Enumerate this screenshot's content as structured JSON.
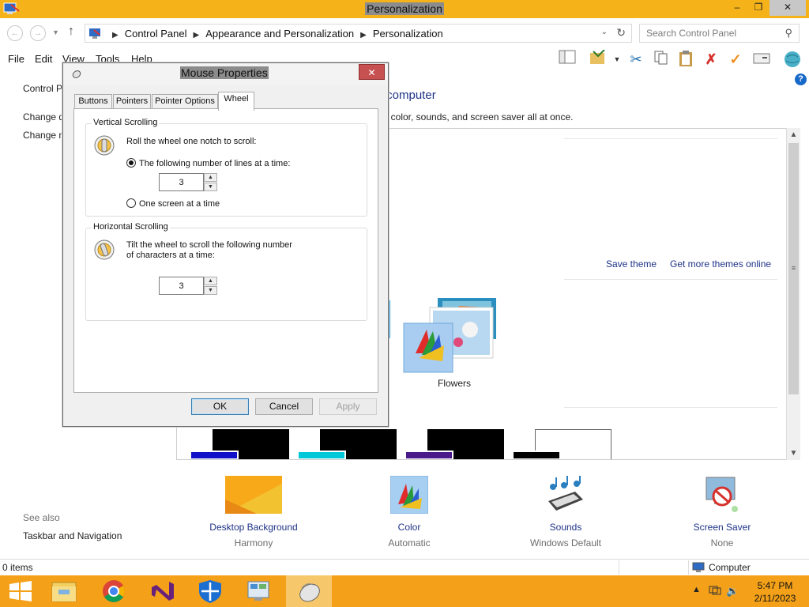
{
  "window": {
    "title": "Personalization",
    "min_label": "‒",
    "max_label": "❐",
    "close_label": "✕"
  },
  "address": {
    "crumbs": [
      "Control Panel",
      "Appearance and Personalization",
      "Personalization"
    ],
    "search_placeholder": "Search Control Panel"
  },
  "menu": [
    "File",
    "Edit",
    "View",
    "Tools",
    "Help"
  ],
  "left_pane": {
    "links": [
      "Control Pa",
      "Change de",
      "Change m"
    ],
    "see_also": "See also",
    "taskbar_link": "Taskbar and Navigation"
  },
  "main": {
    "heading": "r computer",
    "subheading": ", color, sounds, and screen saver all at once.",
    "save_theme": "Save theme",
    "get_more": "Get more themes online",
    "theme_name": "Flowers"
  },
  "bottom_items": [
    {
      "label": "Desktop Background",
      "sub": "Harmony"
    },
    {
      "label": "Color",
      "sub": "Automatic"
    },
    {
      "label": "Sounds",
      "sub": "Windows Default"
    },
    {
      "label": "Screen Saver",
      "sub": "None"
    }
  ],
  "status": {
    "items": "0 items",
    "location": "Computer"
  },
  "clock": {
    "time": "5:47 PM",
    "date": "2/11/2023"
  },
  "dialog": {
    "title": "Mouse Properties",
    "close_label": "✕",
    "tabs": [
      "Buttons",
      "Pointers",
      "Pointer Options",
      "Wheel"
    ],
    "active_tab": "Wheel",
    "vertical": {
      "group_label": "Vertical Scrolling",
      "instruction": "Roll the wheel one notch to scroll:",
      "option_lines": "The following number of lines at a time:",
      "lines_value": "3",
      "option_screen": "One screen at a time",
      "selected": "lines"
    },
    "horizontal": {
      "group_label": "Horizontal Scrolling",
      "instruction_line1": "Tilt the wheel to scroll the following number",
      "instruction_line2": "of characters at a time:",
      "chars_value": "3"
    },
    "buttons": {
      "ok": "OK",
      "cancel": "Cancel",
      "apply": "Apply"
    }
  },
  "colors": {
    "title_bar": "#f5b319",
    "taskbar": "#f4a119",
    "link": "#1e3287"
  }
}
